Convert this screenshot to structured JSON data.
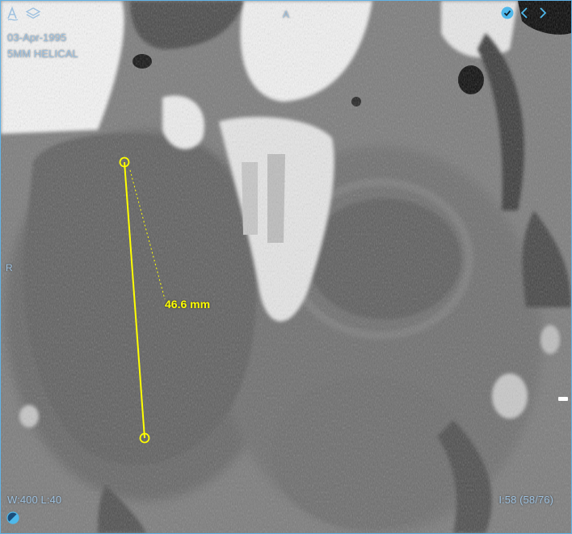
{
  "viewer": {
    "study_date": "03-Apr-1995",
    "series_description": "5MM HELICAL",
    "orientation_top": "A",
    "orientation_left": "R",
    "window_level": "W:400  L:40",
    "image_index": "I:58 (58/76)"
  },
  "measurement": {
    "label": "46.6 mm",
    "color": "#ffff00"
  },
  "toolbar": {
    "icons": [
      "annotation-icon",
      "layers-icon",
      "checkmark-icon",
      "chevron-left-icon",
      "chevron-right-icon"
    ]
  },
  "colors": {
    "accent": "#62b3e6",
    "overlay_text": "#9fc2e0",
    "check_badge": "#4fb8ea"
  }
}
